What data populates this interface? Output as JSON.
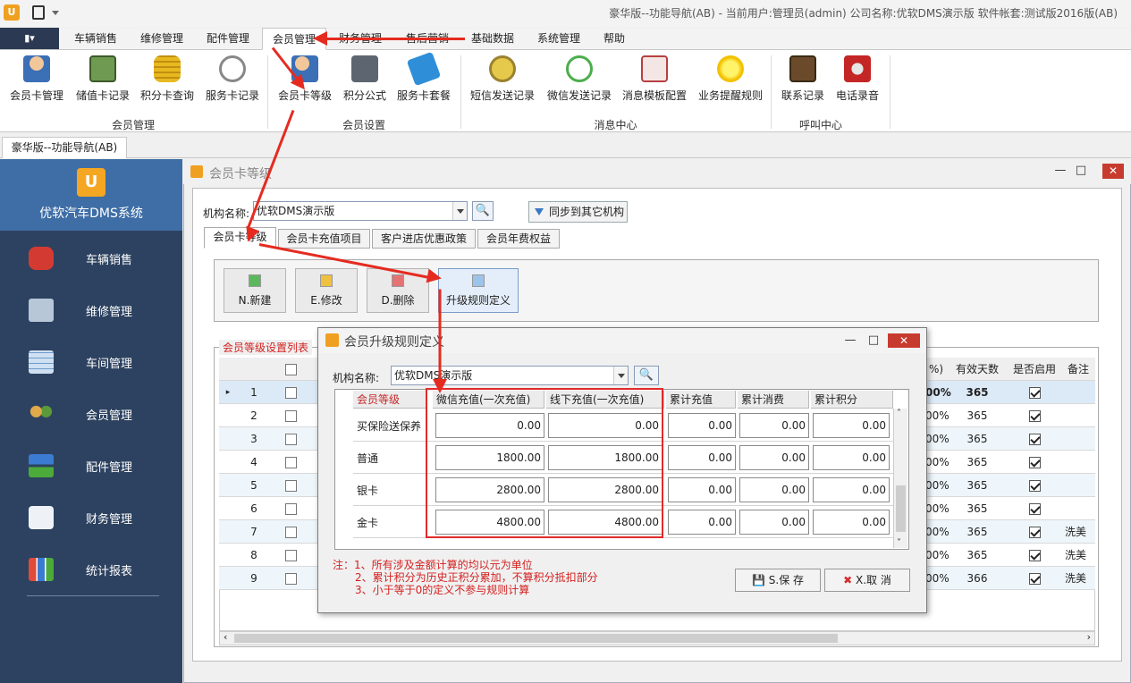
{
  "window": {
    "title": "豪华版--功能导航(AB) - 当前用户:管理员(admin) 公司名称:优软DMS演示版 软件帐套:测试版2016版(AB)",
    "logo_text": "U"
  },
  "menu": {
    "file_label": "▮▾",
    "items": [
      "车辆销售",
      "维修管理",
      "配件管理",
      "会员管理",
      "财务管理",
      "售后营销",
      "基础数据",
      "系统管理",
      "帮助"
    ],
    "active": "会员管理"
  },
  "ribbon": {
    "buttons": [
      {
        "label": "会员卡管理",
        "icon": "member-user-icon"
      },
      {
        "label": "储值卡记录",
        "icon": "cash-card-icon"
      },
      {
        "label": "积分卡查询",
        "icon": "coin-stack-icon"
      },
      {
        "label": "服务卡记录",
        "icon": "stopwatch-icon"
      },
      {
        "label": "会员卡等级",
        "icon": "member-gear-icon"
      },
      {
        "label": "积分公式",
        "icon": "calculator-icon"
      },
      {
        "label": "服务卡套餐",
        "icon": "tag-icon"
      },
      {
        "label": "短信发送记录",
        "icon": "sms-icon"
      },
      {
        "label": "微信发送记录",
        "icon": "wechat-icon"
      },
      {
        "label": "消息模板配置",
        "icon": "template-icon"
      },
      {
        "label": "业务提醒规则",
        "icon": "bulb-icon"
      },
      {
        "label": "联系记录",
        "icon": "contact-book-icon"
      },
      {
        "label": "电话录音",
        "icon": "microphone-icon"
      }
    ],
    "groups": [
      "会员管理",
      "会员设置",
      "消息中心",
      "呼叫中心"
    ]
  },
  "doc_tab": "豪华版--功能导航(AB)",
  "sidebar": {
    "title": "优软汽车DMS系统",
    "items": [
      "车辆销售",
      "维修管理",
      "车间管理",
      "会员管理",
      "配件管理",
      "财务管理",
      "统计报表"
    ]
  },
  "main": {
    "title": "会员卡等级",
    "org_label": "机构名称:",
    "org_value": "优软DMS演示版",
    "sync_label": "同步到其它机构",
    "tabs": [
      "会员卡等级",
      "会员卡充值项目",
      "客户进店优惠政策",
      "会员年费权益"
    ],
    "toolbar": [
      "N.新建",
      "E.修改",
      "D.删除",
      "升级规则定义"
    ],
    "list_title": "会员等级设置列表",
    "col_headers": {
      "pct": "%)",
      "days": "有效天数",
      "enabled": "是否启用",
      "note": "备注"
    },
    "rows": [
      {
        "no": "1",
        "pct": "00%",
        "days": "365",
        "note": ""
      },
      {
        "no": "2",
        "pct": "00%",
        "days": "365",
        "note": ""
      },
      {
        "no": "3",
        "pct": "00%",
        "days": "365",
        "note": ""
      },
      {
        "no": "4",
        "pct": "00%",
        "days": "365",
        "note": ""
      },
      {
        "no": "5",
        "pct": "00%",
        "days": "365",
        "note": ""
      },
      {
        "no": "6",
        "pct": "00%",
        "days": "365",
        "note": ""
      },
      {
        "no": "7",
        "pct": "00%",
        "days": "365",
        "note": "洗美"
      },
      {
        "no": "8",
        "pct": "00%",
        "days": "365",
        "note": "洗美"
      },
      {
        "no": "9",
        "pct": "00%",
        "days": "366",
        "note": "洗美"
      }
    ]
  },
  "dialog": {
    "title": "会员升级规则定义",
    "org_label": "机构名称:",
    "org_value": "优软DMS演示版",
    "headers": [
      "会员等级",
      "微信充值(一次充值)",
      "线下充值(一次充值)",
      "累计充值",
      "累计消费",
      "累计积分"
    ],
    "rows": [
      {
        "name": "买保险送保养",
        "wechat": "0.00",
        "offline": "0.00",
        "total_recharge": "0.00",
        "total_consume": "0.00",
        "total_points": "0.00"
      },
      {
        "name": "普通",
        "wechat": "1800.00",
        "offline": "1800.00",
        "total_recharge": "0.00",
        "total_consume": "0.00",
        "total_points": "0.00"
      },
      {
        "name": "银卡",
        "wechat": "2800.00",
        "offline": "2800.00",
        "total_recharge": "0.00",
        "total_consume": "0.00",
        "total_points": "0.00"
      },
      {
        "name": "金卡",
        "wechat": "4800.00",
        "offline": "4800.00",
        "total_recharge": "0.00",
        "total_consume": "0.00",
        "total_points": "0.00"
      }
    ],
    "notes": [
      "注：1、所有涉及金额计算的均以元为单位",
      "2、累计积分为历史正积分累加，不算积分抵扣部分",
      "3、小于等于0的定义不参与规则计算"
    ],
    "save_label": "S.保 存",
    "cancel_label": "X.取 消"
  },
  "colors": {
    "accent_red": "#e52b20",
    "sidebar": "#2d4260",
    "titlebar_close": "#c73b2e"
  }
}
